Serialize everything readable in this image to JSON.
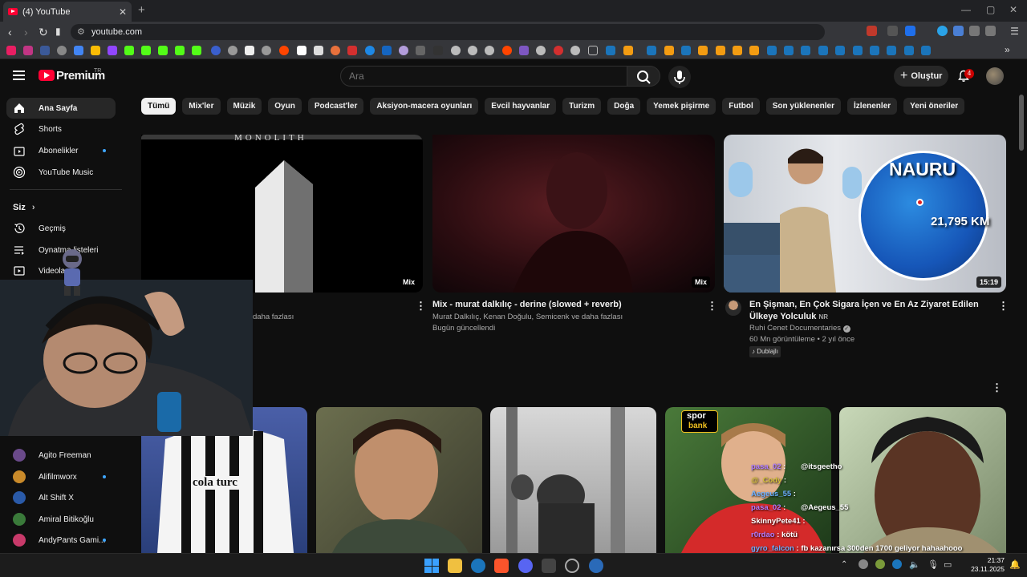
{
  "browser": {
    "tab_title": "(4) YouTube",
    "tab_close": "✕",
    "new_tab": "+",
    "url": "youtube.com"
  },
  "header": {
    "brand": "Premium",
    "brand_region": "TR",
    "search_placeholder": "Ara",
    "create_label": "Oluştur",
    "notifications_count": "4"
  },
  "chips": [
    "Tümü",
    "Mix'ler",
    "Müzik",
    "Oyun",
    "Podcast'ler",
    "Aksiyon-macera oyunları",
    "Evcil hayvanlar",
    "Turizm",
    "Doğa",
    "Yemek pişirme",
    "Futbol",
    "Son yüklenenler",
    "İzlenenler",
    "Yeni öneriler"
  ],
  "sidebar": {
    "main": [
      {
        "label": "Ana Sayfa",
        "icon": "home-icon"
      },
      {
        "label": "Shorts",
        "icon": "shorts-icon"
      },
      {
        "label": "Abonelikler",
        "icon": "subscriptions-icon"
      },
      {
        "label": "YouTube Music",
        "icon": "youtube-music-icon"
      }
    ],
    "you_heading": "Siz",
    "you": [
      {
        "label": "Geçmiş",
        "icon": "history-icon"
      },
      {
        "label": "Oynatma listeleri",
        "icon": "playlist-icon"
      },
      {
        "label": "Videolar",
        "icon": "videos-icon"
      }
    ],
    "subscriptions": [
      {
        "label": "Agito Freeman",
        "color": "#6a4a8a"
      },
      {
        "label": "Alifilmworx",
        "color": "#c98a2a"
      },
      {
        "label": "Alt Shift X",
        "color": "#2a5aa8"
      },
      {
        "label": "Amiral Bitikoğlu",
        "color": "#3a7a3a"
      },
      {
        "label": "AndyPants Gami...",
        "color": "#c83a6a"
      }
    ]
  },
  "videos": [
    {
      "title": "",
      "meta1": "daha fazlası",
      "meta2": "",
      "badge": "Mix",
      "thumb_text": "MONOLITH"
    },
    {
      "title": "Mix - murat dalkılıç - derine (slowed + reverb)",
      "meta1": "Murat Dalkılıç, Kenan Doğulu, Semicenk ve daha fazlası",
      "meta2": "Bugün güncellendi",
      "badge": "Mix"
    },
    {
      "title": "En Şişman, En Çok Sigara İçen ve En Az Ziyaret Edilen Ülkeye Yolculuk",
      "title_badge": "NR",
      "channel": "Ruhi Cenet Documentaries",
      "meta2": "60 Mn görüntüleme • 2 yıl önce",
      "tag": "Dublajlı",
      "badge": "15:19",
      "thumb_text": "NAURU",
      "thumb_km": "21,795 KM"
    }
  ],
  "thumb4_text": {
    "shirt": "cola turc",
    "logo_top": "spor",
    "logo_bottom": "bank"
  },
  "chat": [
    {
      "user": "pasa_02",
      "color": "#b07cff",
      "msg": "@itsgeetho"
    },
    {
      "user": "@_Cody",
      "color": "#d8c43a",
      "msg": ""
    },
    {
      "user": "Aegeus_55",
      "color": "#6cb0ff",
      "msg": ""
    },
    {
      "user": "pasa_02",
      "color": "#b07cff",
      "msg": "@Aegeus_55"
    },
    {
      "user": "SkinnyPete41",
      "color": "#ffffff",
      "msg": ""
    },
    {
      "user": "r0rdao",
      "color": "#b07cff",
      "msg": "kötü"
    },
    {
      "user": "gyro_falcon",
      "color": "#6cb0ff",
      "msg": "fb kazanırsa 300den 1700 geliyor hahaahooo"
    }
  ],
  "clock": {
    "time": "21:37",
    "date": "23.11.2025"
  }
}
